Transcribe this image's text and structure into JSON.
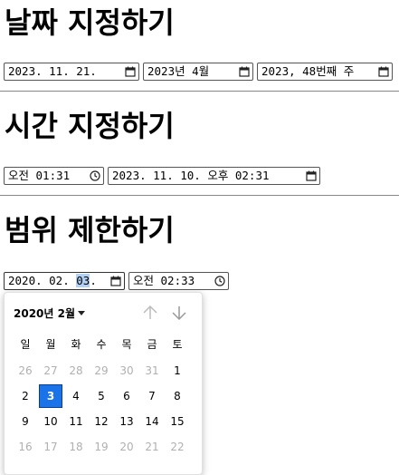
{
  "sections": {
    "date_title": "날짜 지정하기",
    "time_title": "시간 지정하기",
    "range_title": "범위 제한하기"
  },
  "date_inputs": {
    "date": "2023. 11. 21.",
    "month": "2023년 4월",
    "week": "2023, 48번째 주"
  },
  "time_inputs": {
    "time": "오전 01:31",
    "datetime": "2023. 11. 10. 오후 02:31"
  },
  "range_inputs": {
    "date_prefix": "2020. 02. ",
    "date_day": "03",
    "date_suffix": ".",
    "time": "오전 02:33"
  },
  "calendar": {
    "month_label": "2020년 2월",
    "weekdays": [
      "일",
      "월",
      "화",
      "수",
      "목",
      "금",
      "토"
    ],
    "weeks": [
      [
        "26",
        "27",
        "28",
        "29",
        "30",
        "31",
        "1"
      ],
      [
        "2",
        "3",
        "4",
        "5",
        "6",
        "7",
        "8"
      ],
      [
        "9",
        "10",
        "11",
        "12",
        "13",
        "14",
        "15"
      ],
      [
        "16",
        "17",
        "18",
        "19",
        "20",
        "21",
        "22"
      ]
    ],
    "selected": "3"
  },
  "icons": {
    "calendar": "calendar-icon",
    "clock": "clock-icon",
    "prev": "arrow-up-icon",
    "next": "arrow-down-icon"
  },
  "colors": {
    "selected_day": "#1a73e8",
    "muted_day": "#b0b0b0",
    "segment_highlight": "#b3d1f5"
  }
}
